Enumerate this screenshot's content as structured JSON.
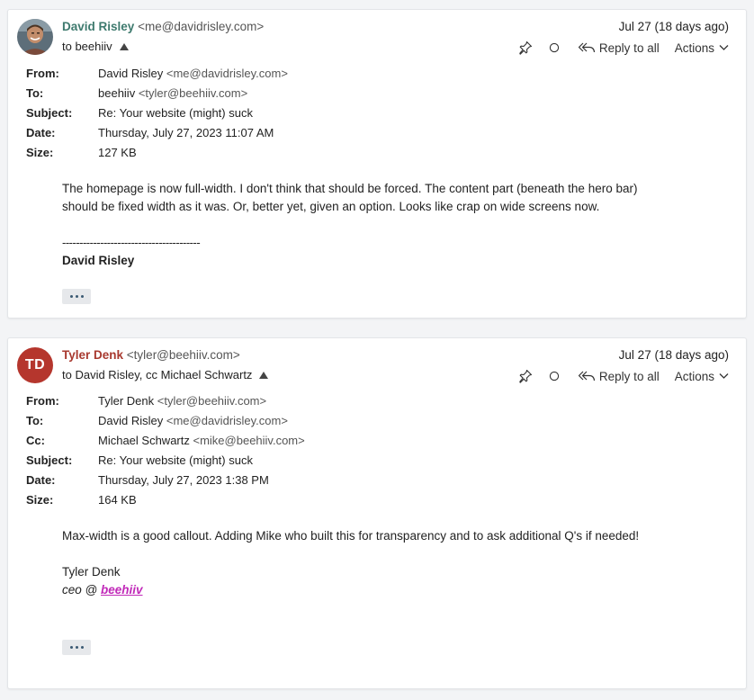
{
  "messages": [
    {
      "sender_name": "David Risley",
      "sender_email": "<me@davidrisley.com>",
      "sender_color": "#3e7a6e",
      "recipients_line": "to beehiiv",
      "date_short": "Jul 27 (18 days ago)",
      "toolbar": {
        "reply_all": "Reply to all",
        "actions": "Actions"
      },
      "meta": {
        "from_label": "From:",
        "from_name": "David Risley",
        "from_email": "<me@davidrisley.com>",
        "to_label": "To:",
        "to_name": "beehiiv",
        "to_email": "<tyler@beehiiv.com>",
        "subject_label": "Subject:",
        "subject": "Re: Your website (might) suck",
        "date_label": "Date:",
        "date": "Thursday, July 27, 2023 11:07 AM",
        "size_label": "Size:",
        "size": "127 KB"
      },
      "body_lines": [
        "The homepage is now full-width. I don't think that should be forced. The content part (beneath the hero bar)",
        "should be fixed width as it was. Or, better yet, given an option. Looks like crap on wide screens now."
      ],
      "signature_separator": "----------------------------------------",
      "signature_name": "David Risley"
    },
    {
      "avatar_initials": "TD",
      "avatar_color": "#b5362d",
      "sender_name": "Tyler Denk",
      "sender_email": "<tyler@beehiiv.com>",
      "sender_color": "#a8392f",
      "recipients_line": "to David Risley, cc Michael Schwartz",
      "date_short": "Jul 27 (18 days ago)",
      "toolbar": {
        "reply_all": "Reply to all",
        "actions": "Actions"
      },
      "meta": {
        "from_label": "From:",
        "from_name": "Tyler Denk",
        "from_email": "<tyler@beehiiv.com>",
        "to_label": "To:",
        "to_name": "David Risley",
        "to_email": "<me@davidrisley.com>",
        "cc_label": "Cc:",
        "cc_name": "Michael Schwartz",
        "cc_email": "<mike@beehiiv.com>",
        "subject_label": "Subject:",
        "subject": "Re: Your website (might) suck",
        "date_label": "Date:",
        "date": "Thursday, July 27, 2023 1:38 PM",
        "size_label": "Size:",
        "size": "164 KB"
      },
      "body_line": "Max-width is a good callout. Adding Mike who built this for transparency and to ask additional Q's if needed!",
      "signature_name": "Tyler Denk",
      "signature_title_prefix": "ceo @",
      "signature_link": "beehiiv",
      "link_color": "#c12ab9"
    }
  ]
}
